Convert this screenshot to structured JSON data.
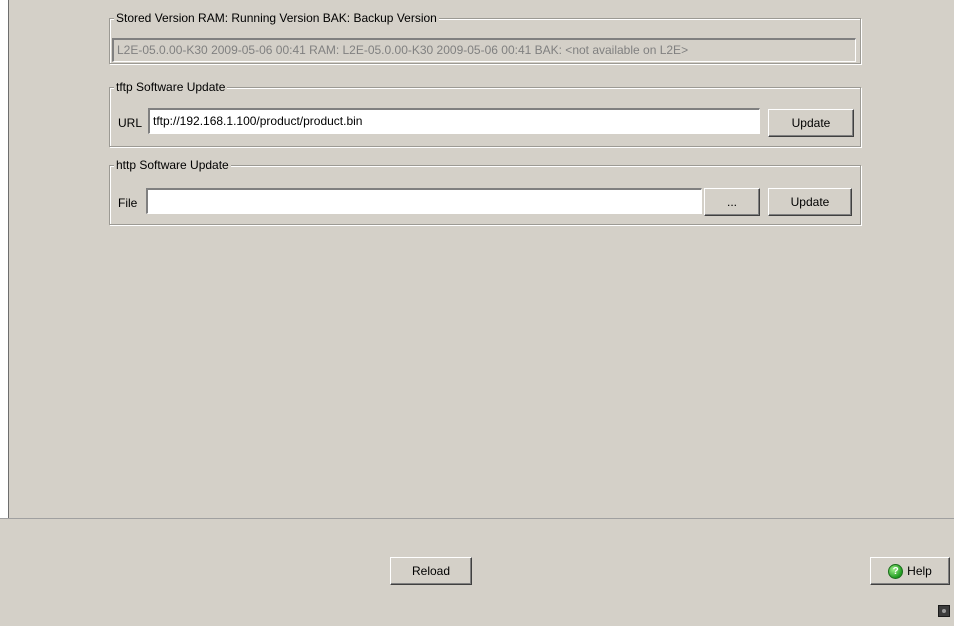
{
  "stored_version": {
    "legend": "Stored Version  RAM:  Running Version BAK: Backup Version",
    "value": "L2E-05.0.00-K30 2009-05-06 00:41 RAM: L2E-05.0.00-K30 2009-05-06 00:41 BAK: <not available on L2E>"
  },
  "tftp": {
    "legend": "tftp Software Update",
    "url_label": "URL",
    "url_value": "tftp://192.168.1.100/product/product.bin",
    "update_label": "Update"
  },
  "http": {
    "legend": "http Software Update",
    "file_label": "File",
    "file_value": "",
    "browse_label": "...",
    "update_label": "Update"
  },
  "footer": {
    "reload_label": "Reload",
    "help_label": "Help",
    "help_icon": "help-icon",
    "status_icon": "status-led-icon"
  }
}
